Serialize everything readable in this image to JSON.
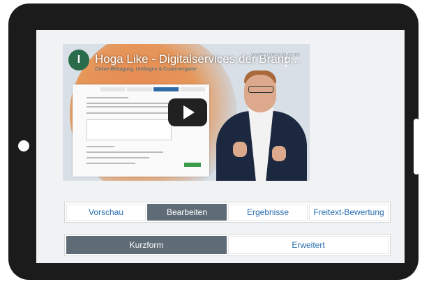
{
  "video": {
    "avatar_letter": "I",
    "title": "Hoga Like - Digitalservices der Brand...",
    "subtitle": "Online-Befragung, Umfragen & Customergame",
    "brand": "www.prescio.com",
    "menu_glyph": "⋮"
  },
  "main_tabs": [
    {
      "label": "Vorschau"
    },
    {
      "label": "Bearbeiten",
      "active": true
    },
    {
      "label": "Ergebnisse"
    },
    {
      "label": "Freitext-Bewertung"
    }
  ],
  "view_tabs": [
    {
      "label": "Kurzform",
      "active": true
    },
    {
      "label": "Erweitert"
    }
  ],
  "colors": {
    "active_tab": "#5f6c78",
    "link_text": "#2a6fb0",
    "play_button": "#212121"
  },
  "icons": [
    "play-icon",
    "menu-dots-icon",
    "channel-avatar"
  ]
}
